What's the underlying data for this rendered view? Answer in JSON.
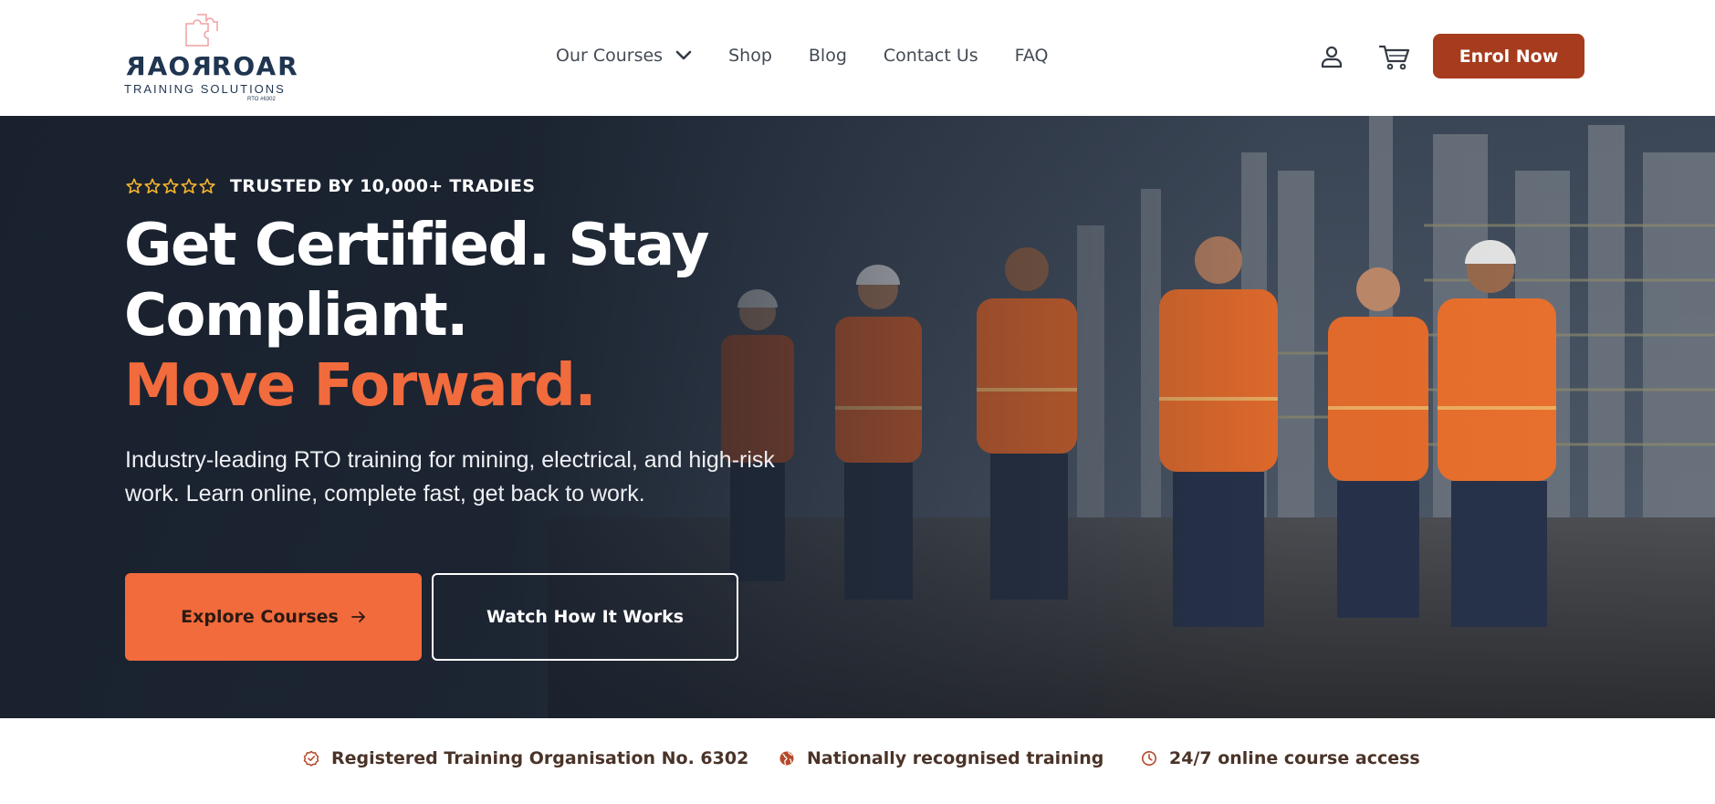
{
  "brand": {
    "name": "ROAR",
    "mirrored": "ROAR",
    "tagline": "TRAINING SOLUTIONS",
    "rto": "RTO #6302",
    "primary_color": "#1f3550",
    "accent_color": "#f26b3d",
    "cta_color": "#a63c1d"
  },
  "nav": {
    "items": [
      {
        "label": "Our Courses",
        "icon": "chevron-down-icon"
      },
      {
        "label": "Shop"
      },
      {
        "label": "Blog"
      },
      {
        "label": "Contact Us"
      },
      {
        "label": "FAQ"
      }
    ]
  },
  "header_actions": {
    "user_icon": "user-icon",
    "cart_icon": "cart-icon",
    "enrol_label": "Enrol Now"
  },
  "hero": {
    "stars": 5,
    "trust_text": "TRUSTED BY 10,000+ TRADIES",
    "headline_line1": "Get Certified. Stay",
    "headline_line2": "Compliant.",
    "headline_accent": "Move Forward.",
    "subtext_line1": "Industry-leading RTO training for mining, electrical, and high-risk",
    "subtext_line2": "work. Learn online, complete fast, get back to work.",
    "primary_cta": "Explore Courses",
    "primary_cta_icon": "arrow-right-icon",
    "secondary_cta": "Watch How It Works"
  },
  "features": [
    {
      "icon": "check-badge-icon",
      "text": "Registered Training Organisation No. 6302"
    },
    {
      "icon": "globe-icon",
      "text": "Nationally recognised training"
    },
    {
      "icon": "clock-icon",
      "text": "24/7 online course access"
    }
  ]
}
